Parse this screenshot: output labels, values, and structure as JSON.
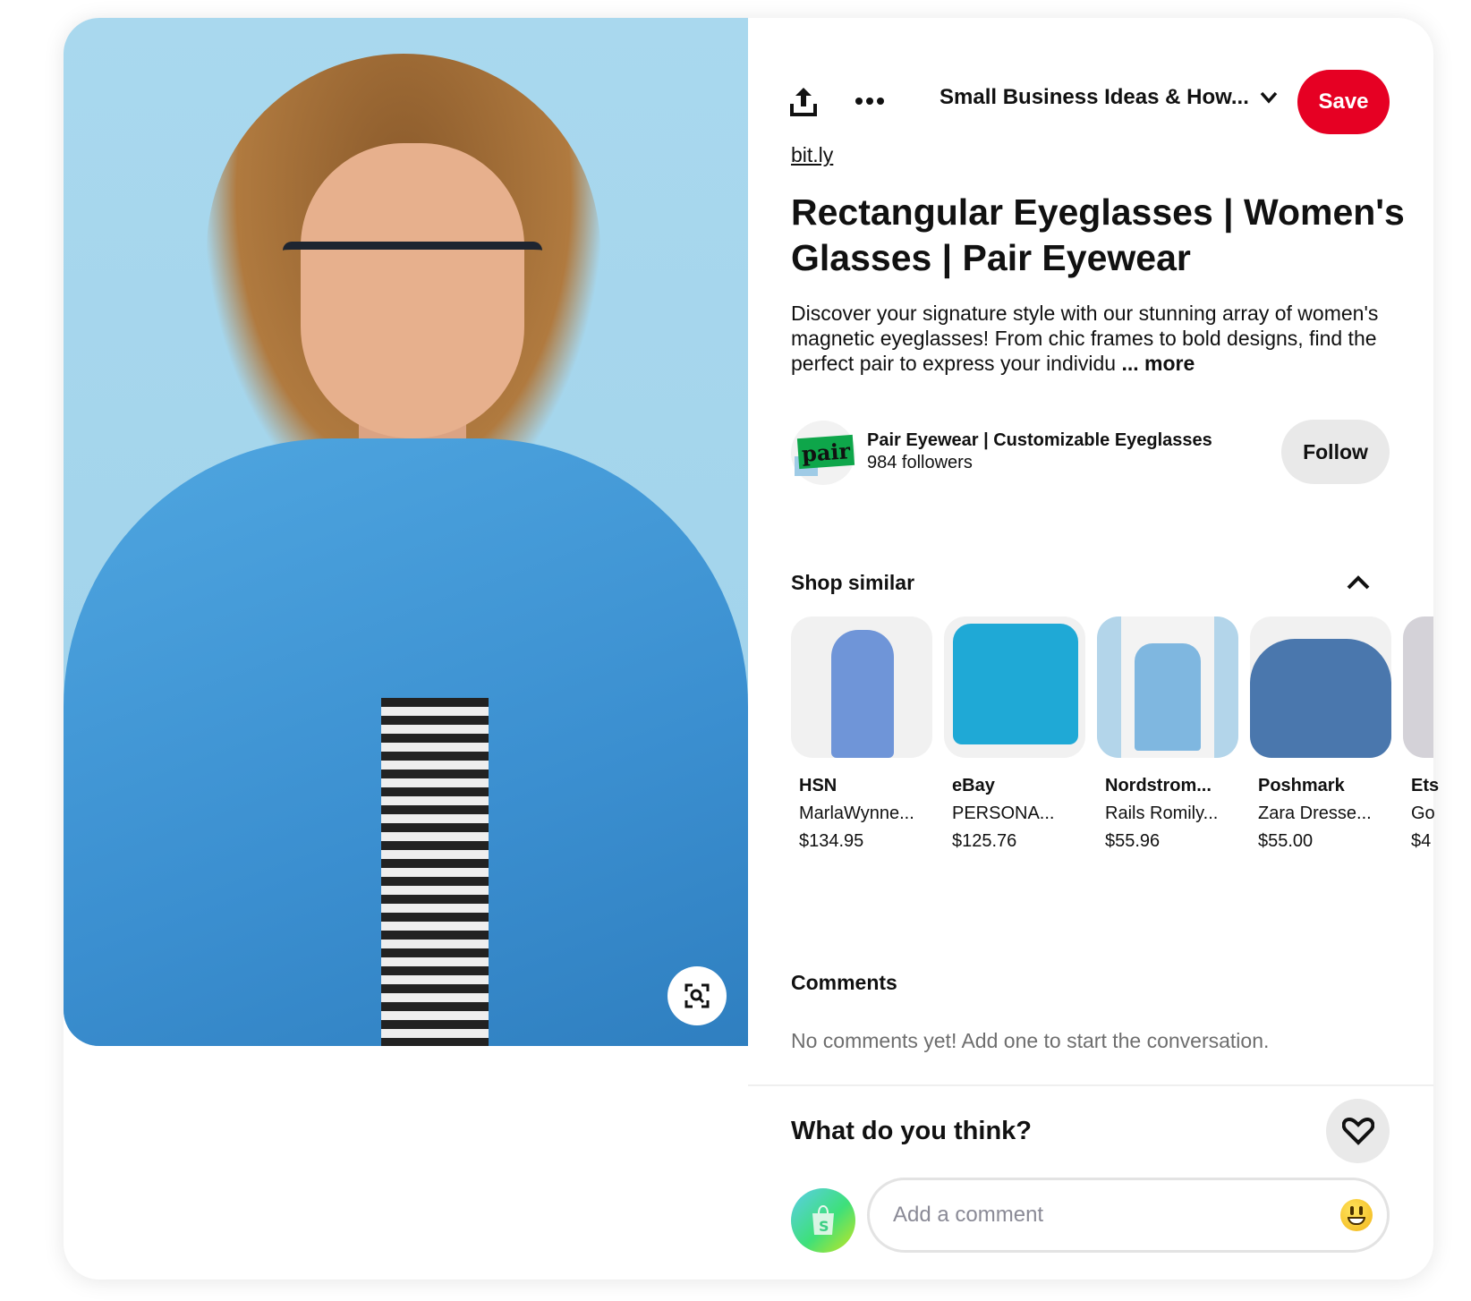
{
  "header": {
    "board_name": "Small Business Ideas & How...",
    "save_label": "Save",
    "share_icon": "share-icon",
    "more_icon": "more-icon"
  },
  "pin": {
    "source_link": "bit.ly",
    "title": "Rectangular Eyeglasses | Women's Glasses | Pair Eyewear",
    "description": "Discover your signature style with our stunning array of women's magnetic eyeglasses! From chic frames to bold designs, find the perfect pair to express your individu",
    "more_label": "... more"
  },
  "owner": {
    "logo_text": "pair",
    "name": "Pair Eyewear | Customizable Eyeglasses",
    "followers": "984 followers",
    "follow_label": "Follow"
  },
  "shop_similar": {
    "title": "Shop similar",
    "items": [
      {
        "store": "HSN",
        "name": "MarlaWynne...",
        "price": "$134.95",
        "color": "#6f95d8"
      },
      {
        "store": "eBay",
        "name": "PERSONA...",
        "price": "$125.76",
        "color": "#1fa9d6"
      },
      {
        "store": "Nordstrom...",
        "name": "Rails Romily...",
        "price": "$55.96",
        "color": "#7fb7e0"
      },
      {
        "store": "Poshmark",
        "name": "Zara Dresse...",
        "price": "$55.00",
        "color": "#4a77ad"
      },
      {
        "store": "Ets",
        "name": "Go",
        "price": "$4",
        "color": "#e8e4ea"
      }
    ]
  },
  "comments": {
    "title": "Comments",
    "empty_text": "No comments yet! Add one to start the conversation.",
    "prompt": "What do you think?",
    "placeholder": "Add a comment"
  },
  "colors": {
    "save": "#e60023",
    "follow_bg": "#e9e9e9"
  }
}
